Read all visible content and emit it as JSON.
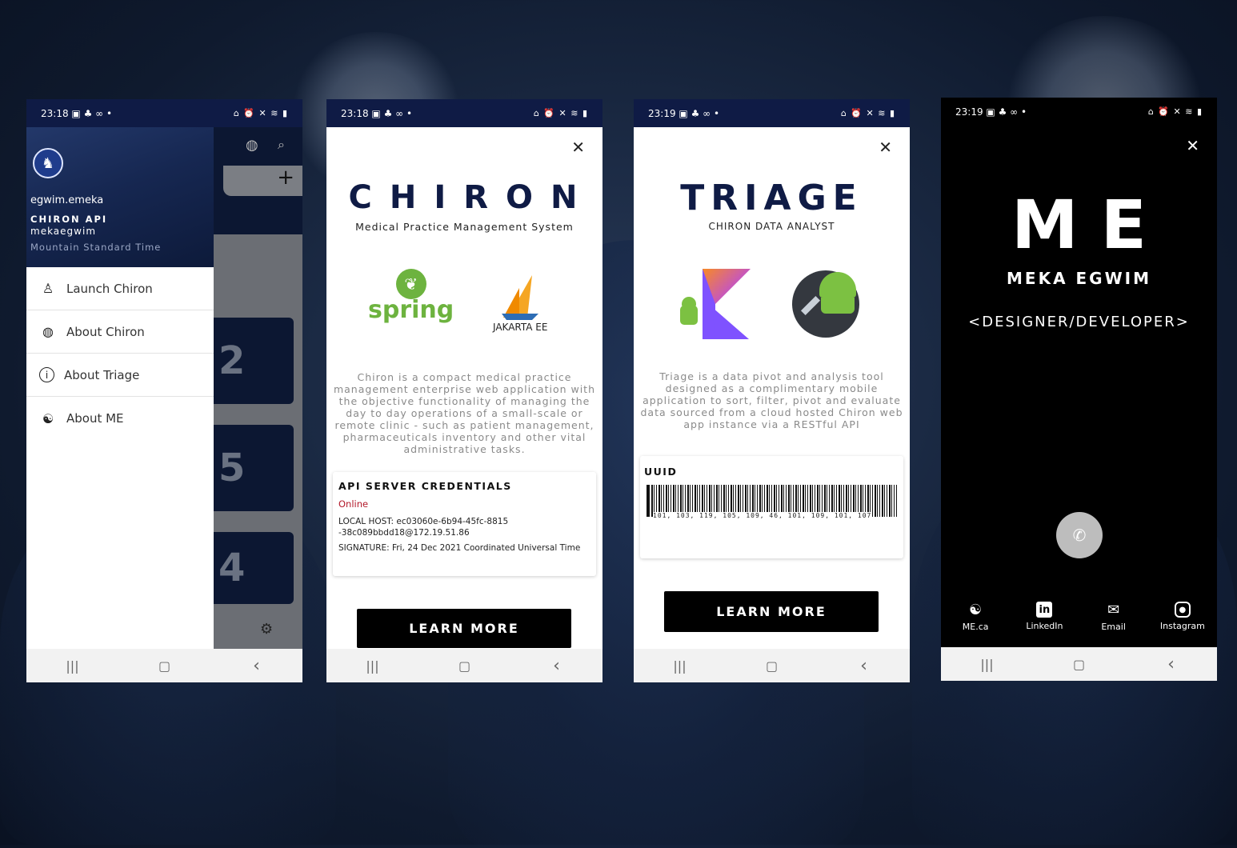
{
  "theme": {
    "navy": "#0f1b45",
    "black": "#000000",
    "white": "#ffffff",
    "online_red": "#b3192a",
    "spring_green": "#6db33f"
  },
  "nav": {
    "recents": "|||",
    "home": "▢",
    "back": "‹"
  },
  "phone1": {
    "status": {
      "time": "23:18",
      "left_icons": "▣ ♣ ∞ •",
      "right_icons": "⌂ ⏰ ✕ ≋ ▮"
    },
    "drawer": {
      "username": "egwim.emeka",
      "app_name": "CHIRON API",
      "handle": "mekaegwim",
      "timezone": "Mountain Standard Time",
      "items": [
        {
          "label": "Launch Chiron",
          "icon": "launch-icon"
        },
        {
          "label": "About Chiron",
          "icon": "globe-icon"
        },
        {
          "label": "About Triage",
          "icon": "info-icon"
        },
        {
          "label": "About ME",
          "icon": "yin-yang-icon"
        }
      ]
    },
    "behind": {
      "tiles": [
        "2",
        "5",
        "4"
      ]
    }
  },
  "phone2": {
    "status": {
      "time": "23:18",
      "left_icons": "▣ ♣ ∞ •",
      "right_icons": "⌂ ⏰ ✕ ≋ ▮"
    },
    "title": "CHIRON",
    "subtitle": "Medical Practice Management System",
    "logo1_text": "spring",
    "logo2_text": "JAKARTA EE",
    "description": "Chiron is a compact medical practice management enterprise web application with the objective functionality of managing the day to day operations of a small-scale or remote clinic - such as patient management, pharmaceuticals inventory and other vital administrative tasks.",
    "credentials": {
      "heading": "API SERVER CREDENTIALS",
      "status": "Online",
      "local_host_line1": "LOCAL HOST: ec03060e-6b94-45fc-8815",
      "local_host_line2": "-38c089bbdd18@172.19.51.86",
      "signature": "SIGNATURE: Fri, 24 Dec 2021 Coordinated Universal Time"
    },
    "button": "LEARN MORE"
  },
  "phone3": {
    "status": {
      "time": "23:19",
      "left_icons": "▣ ♣ ∞ •",
      "right_icons": "⌂ ⏰ ✕ ≋ ▮"
    },
    "title": "TRIAGE",
    "subtitle": "CHIRON DATA ANALYST",
    "description": "Triage is a data pivot and analysis tool designed as a complimentary mobile application to sort, filter, pivot and evaluate data sourced from a cloud hosted Chiron web app instance via a RESTful API",
    "uuid_label": "UUID",
    "barcode_text": "101, 103, 119, 105, 109, 46, 101, 109, 101, 107",
    "button": "LEARN MORE"
  },
  "phone4": {
    "status": {
      "time": "23:19",
      "left_icons": "▣ ♣ ∞ •",
      "right_icons": "⌂ ⏰ ✕ ≋ ▮"
    },
    "title": "ME",
    "name": "MEKA EGWIM",
    "role": "<DESIGNER/DEVELOPER>",
    "links": [
      {
        "label": "ME.ca",
        "icon": "yin-yang-icon"
      },
      {
        "label": "LinkedIn",
        "icon": "linkedin-icon"
      },
      {
        "label": "Email",
        "icon": "email-icon"
      },
      {
        "label": "Instagram",
        "icon": "instagram-icon"
      }
    ]
  }
}
